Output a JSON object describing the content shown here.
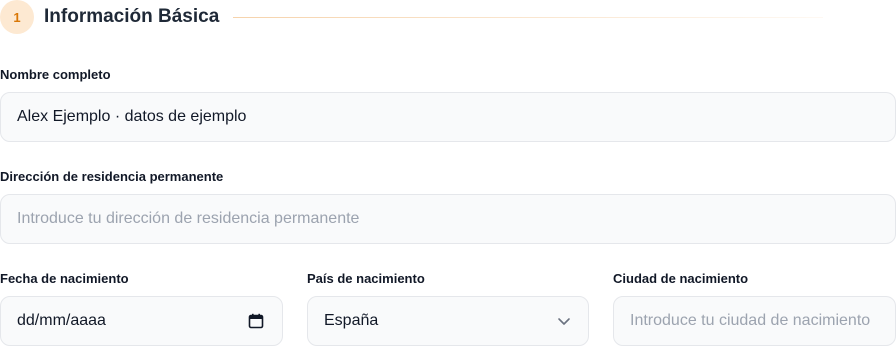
{
  "section": {
    "step_number": "1",
    "title": "Información Básica"
  },
  "fields": {
    "full_name": {
      "label": "Nombre completo",
      "value": "Alex Ejemplo · datos de ejemplo"
    },
    "address": {
      "label": "Dirección de residencia permanente",
      "placeholder": "Introduce tu dirección de residencia permanente"
    },
    "birth_date": {
      "label": "Fecha de nacimiento",
      "placeholder": "dd/mm/aaaa",
      "icon": "calendar-icon"
    },
    "birth_country": {
      "label": "País de nacimiento",
      "selected": "España",
      "icon": "chevron-down-icon"
    },
    "birth_city": {
      "label": "Ciudad de nacimiento",
      "placeholder": "Introduce tu ciudad de nacimiento"
    }
  },
  "colors": {
    "accent": "#d97706",
    "badge_bg": "#fde9d2",
    "field_bg": "#f9fafb",
    "field_border": "#e5e7eb",
    "placeholder": "#9ca3af"
  }
}
